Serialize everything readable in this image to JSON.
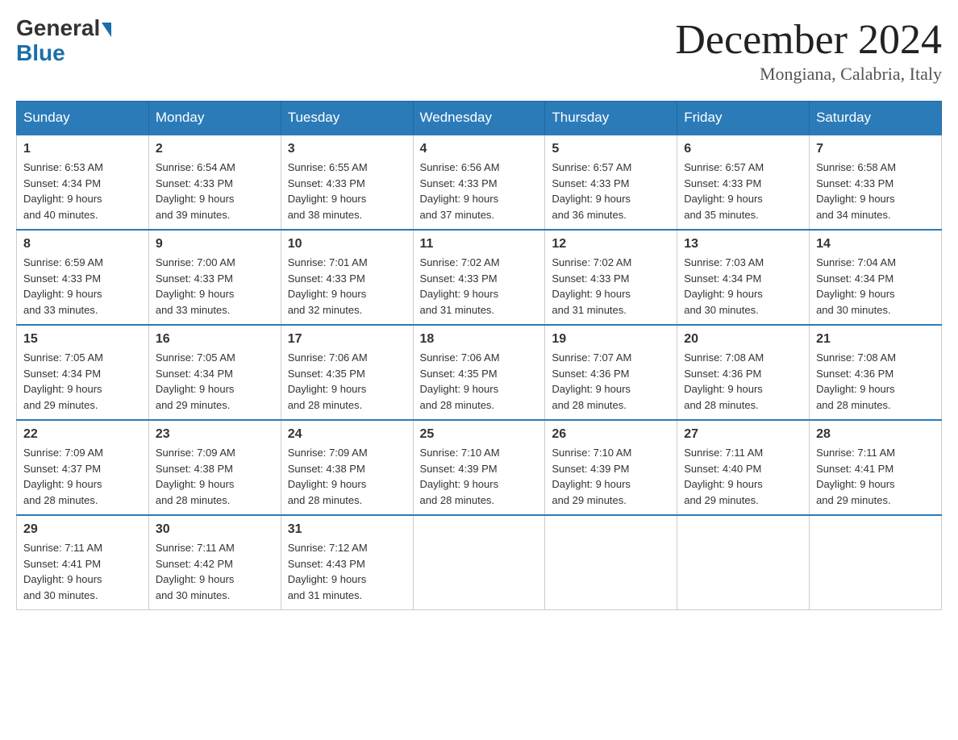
{
  "header": {
    "logo_general": "General",
    "logo_blue": "Blue",
    "month_title": "December 2024",
    "location": "Mongiana, Calabria, Italy"
  },
  "weekdays": [
    "Sunday",
    "Monday",
    "Tuesday",
    "Wednesday",
    "Thursday",
    "Friday",
    "Saturday"
  ],
  "weeks": [
    [
      {
        "day": "1",
        "sunrise": "6:53 AM",
        "sunset": "4:34 PM",
        "daylight": "9 hours and 40 minutes."
      },
      {
        "day": "2",
        "sunrise": "6:54 AM",
        "sunset": "4:33 PM",
        "daylight": "9 hours and 39 minutes."
      },
      {
        "day": "3",
        "sunrise": "6:55 AM",
        "sunset": "4:33 PM",
        "daylight": "9 hours and 38 minutes."
      },
      {
        "day": "4",
        "sunrise": "6:56 AM",
        "sunset": "4:33 PM",
        "daylight": "9 hours and 37 minutes."
      },
      {
        "day": "5",
        "sunrise": "6:57 AM",
        "sunset": "4:33 PM",
        "daylight": "9 hours and 36 minutes."
      },
      {
        "day": "6",
        "sunrise": "6:57 AM",
        "sunset": "4:33 PM",
        "daylight": "9 hours and 35 minutes."
      },
      {
        "day": "7",
        "sunrise": "6:58 AM",
        "sunset": "4:33 PM",
        "daylight": "9 hours and 34 minutes."
      }
    ],
    [
      {
        "day": "8",
        "sunrise": "6:59 AM",
        "sunset": "4:33 PM",
        "daylight": "9 hours and 33 minutes."
      },
      {
        "day": "9",
        "sunrise": "7:00 AM",
        "sunset": "4:33 PM",
        "daylight": "9 hours and 33 minutes."
      },
      {
        "day": "10",
        "sunrise": "7:01 AM",
        "sunset": "4:33 PM",
        "daylight": "9 hours and 32 minutes."
      },
      {
        "day": "11",
        "sunrise": "7:02 AM",
        "sunset": "4:33 PM",
        "daylight": "9 hours and 31 minutes."
      },
      {
        "day": "12",
        "sunrise": "7:02 AM",
        "sunset": "4:33 PM",
        "daylight": "9 hours and 31 minutes."
      },
      {
        "day": "13",
        "sunrise": "7:03 AM",
        "sunset": "4:34 PM",
        "daylight": "9 hours and 30 minutes."
      },
      {
        "day": "14",
        "sunrise": "7:04 AM",
        "sunset": "4:34 PM",
        "daylight": "9 hours and 30 minutes."
      }
    ],
    [
      {
        "day": "15",
        "sunrise": "7:05 AM",
        "sunset": "4:34 PM",
        "daylight": "9 hours and 29 minutes."
      },
      {
        "day": "16",
        "sunrise": "7:05 AM",
        "sunset": "4:34 PM",
        "daylight": "9 hours and 29 minutes."
      },
      {
        "day": "17",
        "sunrise": "7:06 AM",
        "sunset": "4:35 PM",
        "daylight": "9 hours and 28 minutes."
      },
      {
        "day": "18",
        "sunrise": "7:06 AM",
        "sunset": "4:35 PM",
        "daylight": "9 hours and 28 minutes."
      },
      {
        "day": "19",
        "sunrise": "7:07 AM",
        "sunset": "4:36 PM",
        "daylight": "9 hours and 28 minutes."
      },
      {
        "day": "20",
        "sunrise": "7:08 AM",
        "sunset": "4:36 PM",
        "daylight": "9 hours and 28 minutes."
      },
      {
        "day": "21",
        "sunrise": "7:08 AM",
        "sunset": "4:36 PM",
        "daylight": "9 hours and 28 minutes."
      }
    ],
    [
      {
        "day": "22",
        "sunrise": "7:09 AM",
        "sunset": "4:37 PM",
        "daylight": "9 hours and 28 minutes."
      },
      {
        "day": "23",
        "sunrise": "7:09 AM",
        "sunset": "4:38 PM",
        "daylight": "9 hours and 28 minutes."
      },
      {
        "day": "24",
        "sunrise": "7:09 AM",
        "sunset": "4:38 PM",
        "daylight": "9 hours and 28 minutes."
      },
      {
        "day": "25",
        "sunrise": "7:10 AM",
        "sunset": "4:39 PM",
        "daylight": "9 hours and 28 minutes."
      },
      {
        "day": "26",
        "sunrise": "7:10 AM",
        "sunset": "4:39 PM",
        "daylight": "9 hours and 29 minutes."
      },
      {
        "day": "27",
        "sunrise": "7:11 AM",
        "sunset": "4:40 PM",
        "daylight": "9 hours and 29 minutes."
      },
      {
        "day": "28",
        "sunrise": "7:11 AM",
        "sunset": "4:41 PM",
        "daylight": "9 hours and 29 minutes."
      }
    ],
    [
      {
        "day": "29",
        "sunrise": "7:11 AM",
        "sunset": "4:41 PM",
        "daylight": "9 hours and 30 minutes."
      },
      {
        "day": "30",
        "sunrise": "7:11 AM",
        "sunset": "4:42 PM",
        "daylight": "9 hours and 30 minutes."
      },
      {
        "day": "31",
        "sunrise": "7:12 AM",
        "sunset": "4:43 PM",
        "daylight": "9 hours and 31 minutes."
      },
      null,
      null,
      null,
      null
    ]
  ],
  "labels": {
    "sunrise": "Sunrise:",
    "sunset": "Sunset:",
    "daylight": "Daylight:"
  }
}
